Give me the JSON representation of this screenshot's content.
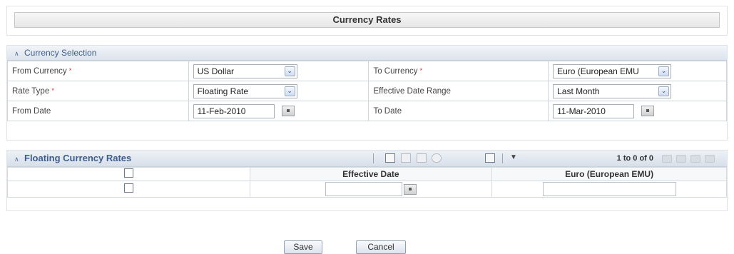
{
  "page_title": "Currency Rates",
  "selection": {
    "header": "Currency Selection",
    "required_mark": "*",
    "from_currency": {
      "label": "From Currency",
      "value": "US Dollar"
    },
    "to_currency": {
      "label": "To Currency",
      "value": "Euro (European EMU"
    },
    "rate_type": {
      "label": "Rate Type",
      "value": "Floating Rate"
    },
    "effective_range": {
      "label": "Effective Date Range",
      "value": "Last Month"
    },
    "from_date": {
      "label": "From Date",
      "value": "11-Feb-2010"
    },
    "to_date": {
      "label": "To Date",
      "value": "11-Mar-2010"
    }
  },
  "floating": {
    "header": "Floating Currency Rates",
    "pager": "1 to 0 of 0",
    "columns": [
      "Effective Date",
      "Euro (European EMU)"
    ],
    "row": {
      "effective_date": "",
      "euro": ""
    }
  },
  "buttons": {
    "save": "Save",
    "cancel": "Cancel"
  },
  "icons": {
    "collapse": "double-chevron-up-icon",
    "calendar": "calendar-icon",
    "dropdown": "chevron-down-icon",
    "toolbar": [
      "add-icon",
      "edit-icon",
      "delete-icon",
      "settings-icon",
      "run-icon",
      "filter-icon"
    ],
    "pager": [
      "first-page-icon",
      "previous-page-icon",
      "next-page-icon",
      "last-page-icon"
    ]
  },
  "colors": {
    "header_text": "#3f5e8c",
    "required": "#dd2233"
  }
}
